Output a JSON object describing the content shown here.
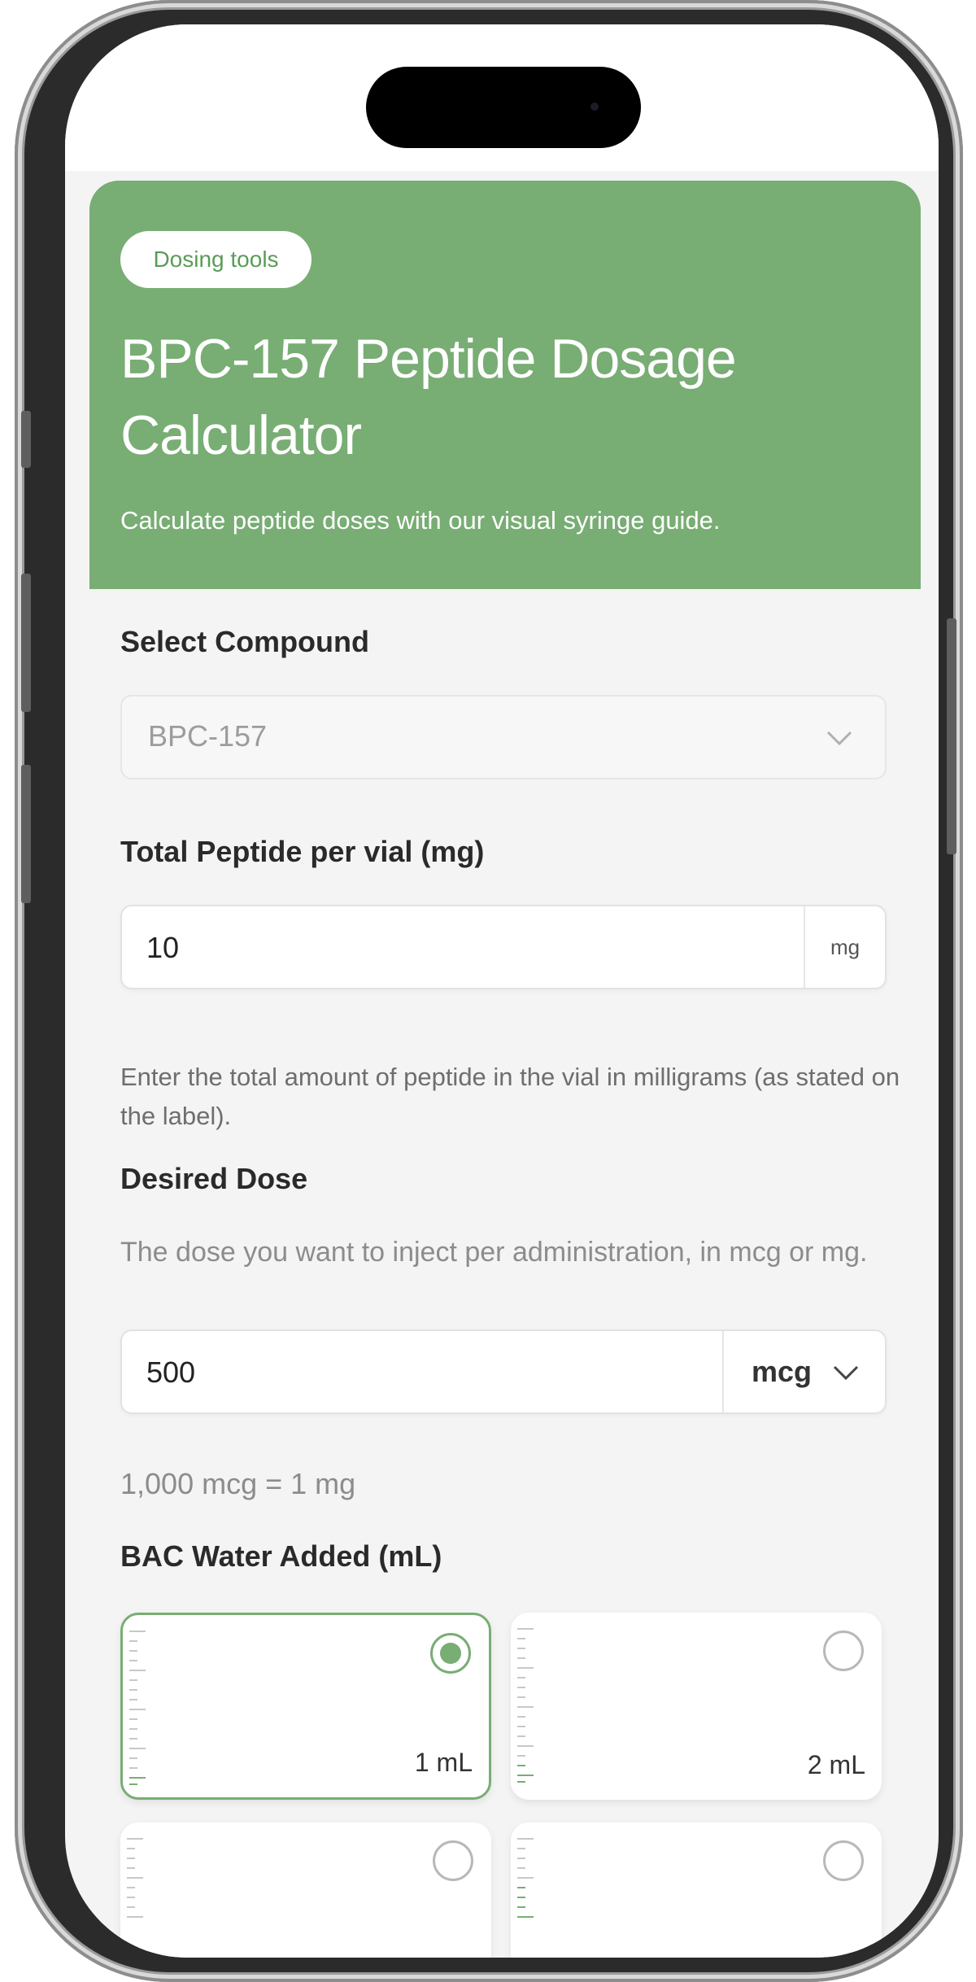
{
  "hero": {
    "badge": "Dosing tools",
    "title": "BPC-157 Peptide Dosage Calculator",
    "subtitle": "Calculate peptide doses with our visual syringe guide."
  },
  "compound": {
    "label": "Select Compound",
    "value": "BPC-157"
  },
  "total_peptide": {
    "label": "Total Peptide per vial (mg)",
    "value": "10",
    "unit": "mg",
    "helper": "Enter the total amount of peptide in the vial in milligrams (as stated on the label)."
  },
  "desired_dose": {
    "label": "Desired Dose",
    "helper": "The dose you want to inject per administration, in mcg or mg.",
    "value": "500",
    "unit": "mcg",
    "conversion": "1,000 mcg = 1 mg"
  },
  "bac_water": {
    "label": "BAC Water Added (mL)",
    "options": [
      {
        "label": "1 mL",
        "selected": true
      },
      {
        "label": "2 mL",
        "selected": false
      },
      {
        "label": "",
        "selected": false
      },
      {
        "label": "",
        "selected": false
      }
    ]
  },
  "colors": {
    "accent": "#78ad74",
    "background": "#f4f4f4",
    "text": "#2a2a2a",
    "muted": "#8c8c8c"
  }
}
